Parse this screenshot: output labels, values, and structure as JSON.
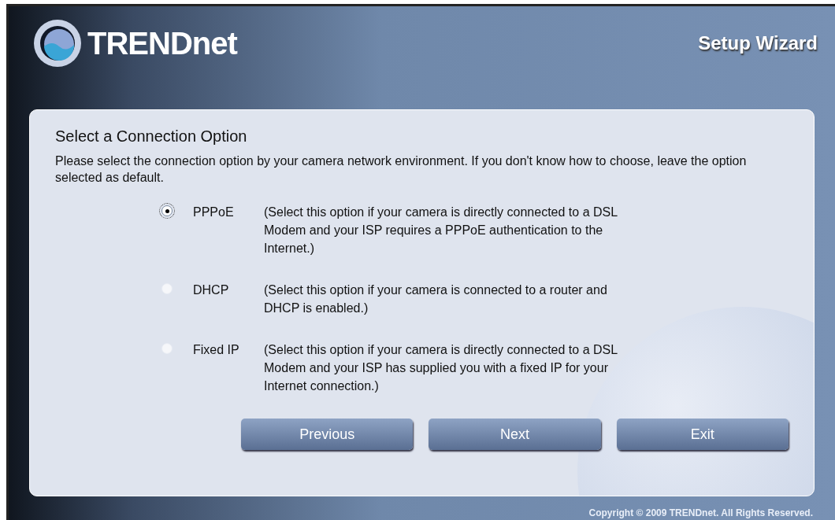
{
  "header": {
    "logo": "TRENDnet",
    "title": "Setup Wizard"
  },
  "panel": {
    "heading": "Select a Connection Option",
    "intro": "Please select the connection option by your camera network environment. If you don't know how to choose, leave the option selected as default."
  },
  "options": [
    {
      "label": "PPPoE",
      "description": "(Select this option if your camera is directly connected to a DSL Modem and your ISP requires a PPPoE authentication to the Internet.)",
      "selected": true
    },
    {
      "label": "DHCP",
      "description": "(Select this option if your camera is connected to a router and DHCP is enabled.)",
      "selected": false
    },
    {
      "label": "Fixed IP",
      "description": "(Select this option if your camera is directly connected to a DSL Modem and your ISP has supplied you with a fixed IP for your Internet connection.)",
      "selected": false
    }
  ],
  "buttons": [
    "Previous",
    "Next",
    "Exit"
  ],
  "footer": "Copyright © 2009 TRENDnet. All Rights Reserved."
}
